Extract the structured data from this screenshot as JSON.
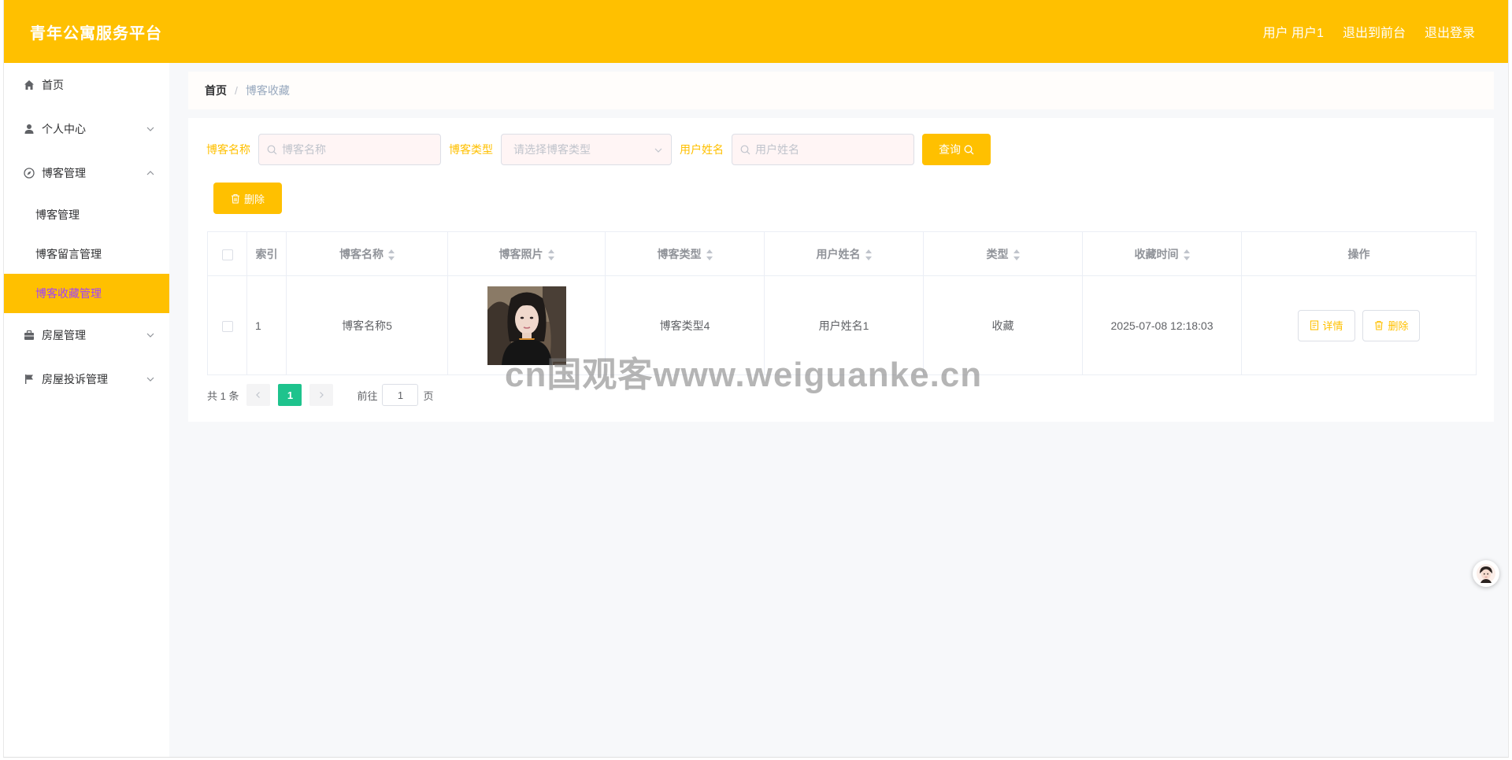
{
  "header": {
    "title": "青年公寓服务平台",
    "user_label": "用户 用户1",
    "to_front": "退出到前台",
    "logout": "退出登录"
  },
  "sidebar": {
    "home": "首页",
    "personal_center": "个人中心",
    "blog_mgmt": "博客管理",
    "sub_blog": "博客管理",
    "sub_comment": "博客留言管理",
    "sub_favorite": "博客收藏管理",
    "house_mgmt": "房屋管理",
    "complaint_mgmt": "房屋投诉管理"
  },
  "breadcrumb": {
    "home": "首页",
    "sep": "/",
    "current": "博客收藏"
  },
  "search": {
    "name_label": "博客名称",
    "name_placeholder": "博客名称",
    "type_label": "博客类型",
    "type_placeholder": "请选择博客类型",
    "user_label": "用户姓名",
    "user_placeholder": "用户姓名",
    "query_button": "查询"
  },
  "actions": {
    "delete_button": "删除"
  },
  "table": {
    "headers": {
      "index": "索引",
      "blog_name": "博客名称",
      "blog_photo": "博客照片",
      "blog_type": "博客类型",
      "user_name": "用户姓名",
      "type": "类型",
      "fav_time": "收藏时间",
      "ops": "操作"
    },
    "rows": [
      {
        "index": "1",
        "blog_name": "博客名称5",
        "blog_type": "博客类型4",
        "user_name": "用户姓名1",
        "type": "收藏",
        "fav_time": "2025-07-08 12:18:03",
        "detail_btn": "详情",
        "delete_btn": "删除"
      }
    ]
  },
  "pagination": {
    "total": "共 1 条",
    "current_page": "1",
    "goto_label": "前往",
    "goto_value": "1",
    "page_suffix": "页"
  },
  "watermark": "cn国观客www.weiguanke.cn",
  "colors": {
    "accent": "#ffc000",
    "page_active": "#1ec38d",
    "active_text": "#a040ff"
  }
}
